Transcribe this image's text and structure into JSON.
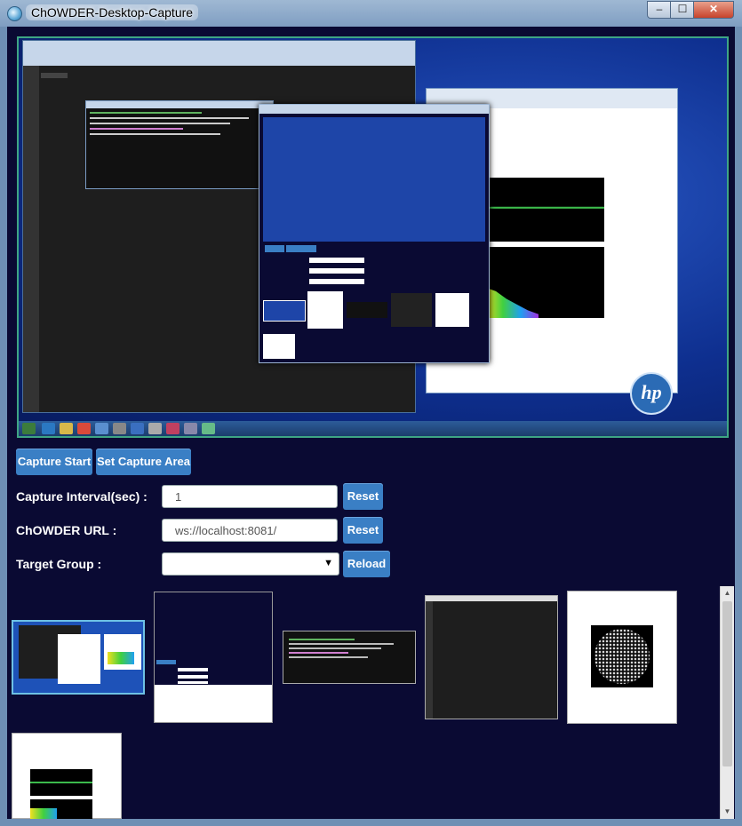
{
  "window": {
    "title": "ChOWDER-Desktop-Capture",
    "minimize_glyph": "–",
    "maximize_glyph": "☐",
    "close_glyph": "✕"
  },
  "controls": {
    "capture_start_label": "Capture Start",
    "set_capture_area_label": "Set Capture Area",
    "interval_label": "Capture Interval(sec) :",
    "interval_value": "1",
    "interval_reset_label": "Reset",
    "url_label": "ChOWDER URL :",
    "url_value": "ws://localhost:8081/",
    "url_reset_label": "Reset",
    "group_label": "Target Group :",
    "group_value": "",
    "group_reload_label": "Reload"
  },
  "preview": {
    "logo_text": "hp"
  },
  "thumbnails": [
    {
      "kind": "desktop"
    },
    {
      "kind": "app-window"
    },
    {
      "kind": "terminal"
    },
    {
      "kind": "editor"
    },
    {
      "kind": "particle-image"
    },
    {
      "kind": "spectrum-browser"
    }
  ],
  "colors": {
    "background": "#0a0a33",
    "button": "#3a7fc5",
    "preview_border": "#3ea584"
  }
}
